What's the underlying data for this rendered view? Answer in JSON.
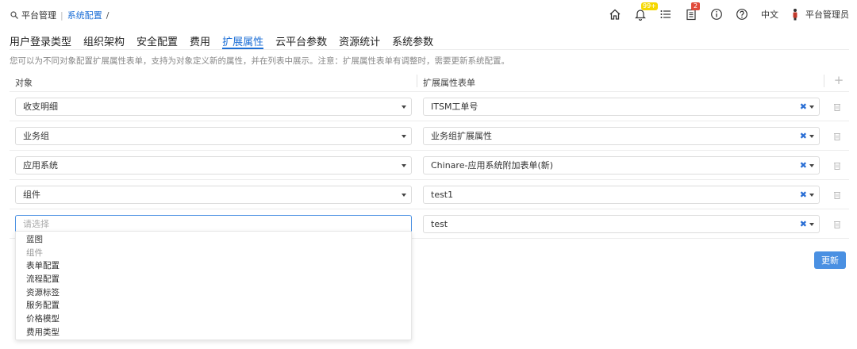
{
  "breadcrumb": {
    "root": "平台管理",
    "separator": "|",
    "current": "系统配置",
    "trail": "/"
  },
  "toolbar": {
    "notification_badge": "99+",
    "tasks_badge": "2",
    "language": "中文",
    "user_name": "平台管理员"
  },
  "tabs": [
    {
      "label": "用户登录类型",
      "active": false
    },
    {
      "label": "组织架构",
      "active": false
    },
    {
      "label": "安全配置",
      "active": false
    },
    {
      "label": "费用",
      "active": false
    },
    {
      "label": "扩展属性",
      "active": true
    },
    {
      "label": "云平台参数",
      "active": false
    },
    {
      "label": "资源统计",
      "active": false
    },
    {
      "label": "系统参数",
      "active": false
    }
  ],
  "description": "您可以为不同对象配置扩展属性表单，支持为对象定义新的属性，并在列表中展示。注意：扩展属性表单有调整时，需要更新系统配置。",
  "table": {
    "columns": {
      "object": "对象",
      "form": "扩展属性表单",
      "add": "+"
    },
    "rows": [
      {
        "object": "收支明细",
        "form": "ITSM工单号"
      },
      {
        "object": "业务组",
        "form": "业务组扩展属性"
      },
      {
        "object": "应用系统",
        "form": "Chinare-应用系统附加表单(新)"
      },
      {
        "object": "组件",
        "form": "test1"
      },
      {
        "object": "",
        "object_placeholder": "请选择",
        "form": "test"
      }
    ],
    "clear_symbol": "✖"
  },
  "dropdown": {
    "options": [
      {
        "label": "蓝图",
        "disabled": false
      },
      {
        "label": "组件",
        "disabled": true
      },
      {
        "label": "表单配置",
        "disabled": false
      },
      {
        "label": "流程配置",
        "disabled": false
      },
      {
        "label": "资源标签",
        "disabled": false
      },
      {
        "label": "服务配置",
        "disabled": false
      },
      {
        "label": "价格模型",
        "disabled": false
      },
      {
        "label": "费用类型",
        "disabled": false
      }
    ]
  },
  "update_button": "更新",
  "colors": {
    "accent": "#1d6fd6",
    "button": "#4a90e2",
    "badge_yellow": "#f5d800",
    "badge_red": "#e14b3b"
  }
}
